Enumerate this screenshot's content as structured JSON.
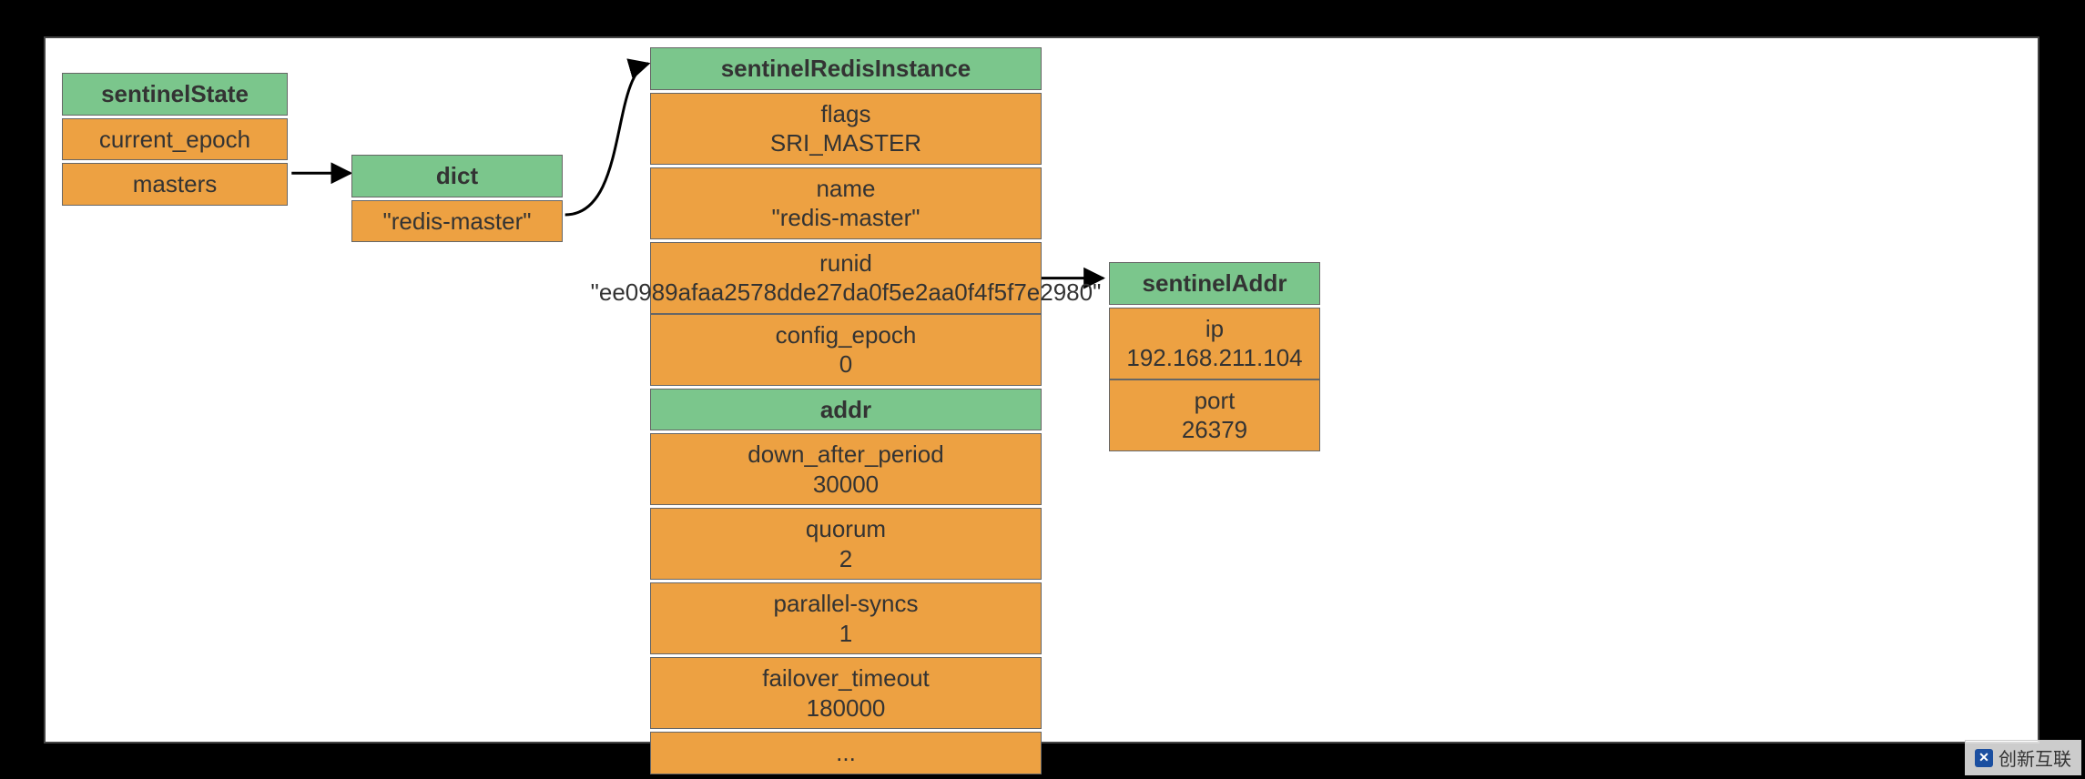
{
  "sentinelState": {
    "title": "sentinelState",
    "rows": [
      "current_epoch",
      "masters"
    ]
  },
  "dict": {
    "title": "dict",
    "rows": [
      "\"redis-master\""
    ]
  },
  "instance": {
    "title": "sentinelRedisInstance",
    "rows": [
      {
        "k": "flags",
        "v": "SRI_MASTER"
      },
      {
        "k": "name",
        "v": "\"redis-master\""
      },
      {
        "k": "runid",
        "v": "\"ee0989afaa2578dde27da0f5e2aa0f4f5f7e2980\""
      },
      {
        "k": "config_epoch",
        "v": "0"
      }
    ],
    "addrTitle": "addr",
    "rows2": [
      {
        "k": "down_after_period",
        "v": "30000"
      },
      {
        "k": "quorum",
        "v": "2"
      },
      {
        "k": "parallel-syncs",
        "v": "1"
      },
      {
        "k": "failover_timeout",
        "v": "180000"
      },
      {
        "k": "...",
        "v": ""
      }
    ]
  },
  "addr": {
    "title": "sentinelAddr",
    "rows": [
      {
        "k": "ip",
        "v": "192.168.211.104"
      },
      {
        "k": "port",
        "v": "26379"
      }
    ]
  },
  "watermark": "创新互联"
}
